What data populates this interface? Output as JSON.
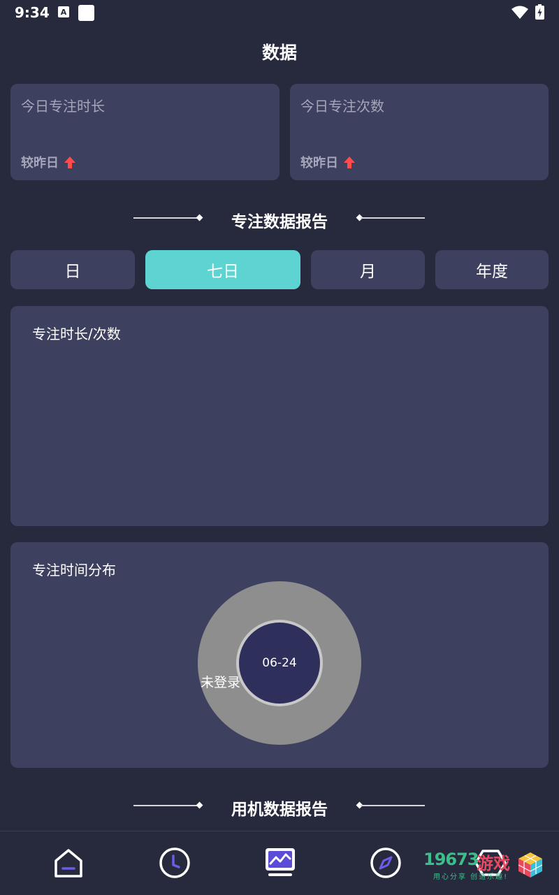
{
  "status_bar": {
    "time": "9:34",
    "icons": [
      "keyboard-a-icon",
      "blank-square-icon",
      "wifi-icon",
      "battery-charging-icon"
    ]
  },
  "page": {
    "title": "数据"
  },
  "stats": {
    "focus_duration": {
      "label": "今日专注时长",
      "compare": "较昨日"
    },
    "focus_count": {
      "label": "今日专注次数",
      "compare": "较昨日"
    },
    "arrow_color": "#ff4d4d"
  },
  "focus_report": {
    "title": "专注数据报告",
    "tabs": [
      {
        "label": "日",
        "active": false
      },
      {
        "label": "七日",
        "active": true
      },
      {
        "label": "月",
        "active": false
      },
      {
        "label": "年度",
        "active": false
      }
    ],
    "accent_color": "#5dd4d2"
  },
  "duration_chart": {
    "title": "专注时长/次数"
  },
  "distribution_chart": {
    "title": "专注时间分布",
    "center_label": "06-24"
  },
  "chart_data": {
    "type": "pie",
    "title": "专注时间分布",
    "categories": [
      "未登录"
    ],
    "values": [
      100
    ],
    "center_label": "06-24",
    "colors": [
      "#8e8e8e"
    ],
    "legend": "none"
  },
  "usage_report": {
    "title": "用机数据报告"
  },
  "bottom_nav": {
    "items": [
      {
        "icon": "home-icon"
      },
      {
        "icon": "clock-icon"
      },
      {
        "icon": "data-chart-icon",
        "active": true
      },
      {
        "icon": "compass-icon"
      },
      {
        "icon": "hexagon-icon"
      }
    ]
  },
  "watermark": {
    "number": "19673",
    "word": "游戏",
    "slogan": "用心分享 创造乐趣!"
  }
}
